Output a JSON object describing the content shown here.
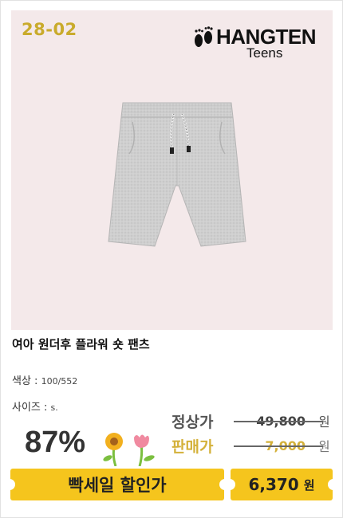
{
  "product": {
    "code": "28-02",
    "brand_name": "HANGTEN",
    "brand_sub": "Teens",
    "title": "여아 원더후 플라워 숏 팬츠"
  },
  "meta": {
    "color_label": "색상 :",
    "color_value": "100/552",
    "size_label": "사이즈 :",
    "size_value": "s."
  },
  "pricing": {
    "discount": "87%",
    "regular_label": "정상가",
    "regular_price": "49,800",
    "regular_currency": "원",
    "sale_label": "판매가",
    "sale_price": "7,000",
    "sale_currency": "원",
    "banner_label": "빡세일 할인가",
    "final_price": "6,370",
    "final_currency": "원"
  },
  "colors": {
    "accent": "#f5c51d",
    "code": "#c9ab2c",
    "photo_bg": "#f4e9ea"
  },
  "icons": [
    "footprint-logo-icon",
    "sunflower-icon",
    "tulip-icon"
  ]
}
